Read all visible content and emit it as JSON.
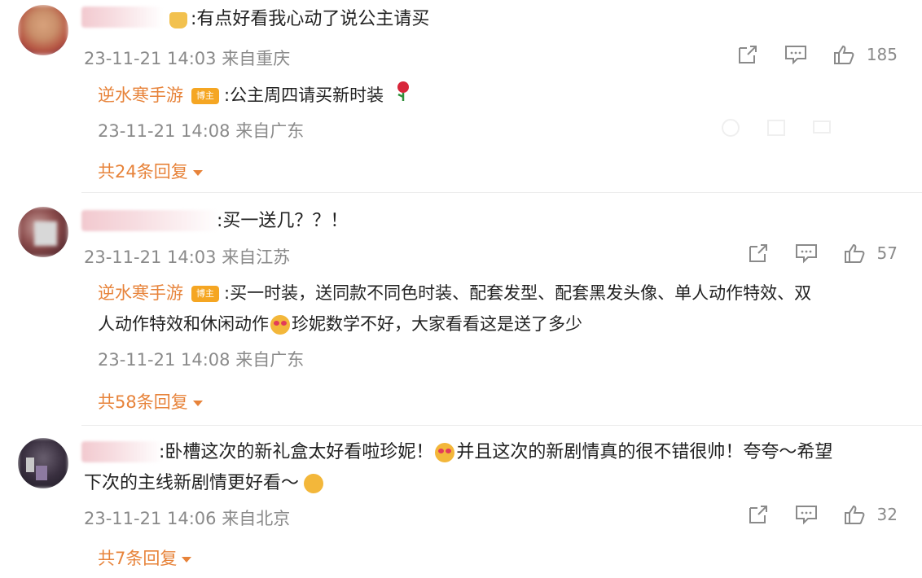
{
  "comments": [
    {
      "text": ":有点好看我心动了说公主请买",
      "time": "23-11-21 14:03",
      "location": "来自重庆",
      "likes": "185",
      "reply": {
        "author": "逆水寒手游",
        "badge": "博主",
        "text": ":公主周四请买新时装",
        "time": "23-11-21 14:08",
        "location": "来自广东"
      },
      "more": "共24条回复"
    },
    {
      "text": ":买一送几？？！",
      "time": "23-11-21 14:03",
      "location": "来自江苏",
      "likes": "57",
      "reply": {
        "author": "逆水寒手游",
        "badge": "博主",
        "text_line1": ":买一时装，送同款不同色时装、配套发型、配套黑发头像、单人动作特效、双",
        "text_line2a": "人动作特效和休闲动作",
        "text_line2b": "珍妮数学不好，大家看看这是送了多少",
        "time": "23-11-21 14:08",
        "location": "来自广东"
      },
      "more": "共58条回复"
    },
    {
      "text_line1a": ":卧槽这次的新礼盒太好看啦珍妮！",
      "text_line1b": "并且这次的新剧情真的很不错很帅！夸夸～希望",
      "text_line2": "下次的主线新剧情更好看～",
      "time": "23-11-21 14:06",
      "location": "来自北京",
      "likes": "32",
      "more": "共7条回复"
    }
  ],
  "icons": {
    "share": "share-icon",
    "comment": "comment-icon",
    "like": "thumbs-up-icon"
  },
  "colors": {
    "accent": "#e7833a",
    "meta": "#8a8a8a"
  }
}
